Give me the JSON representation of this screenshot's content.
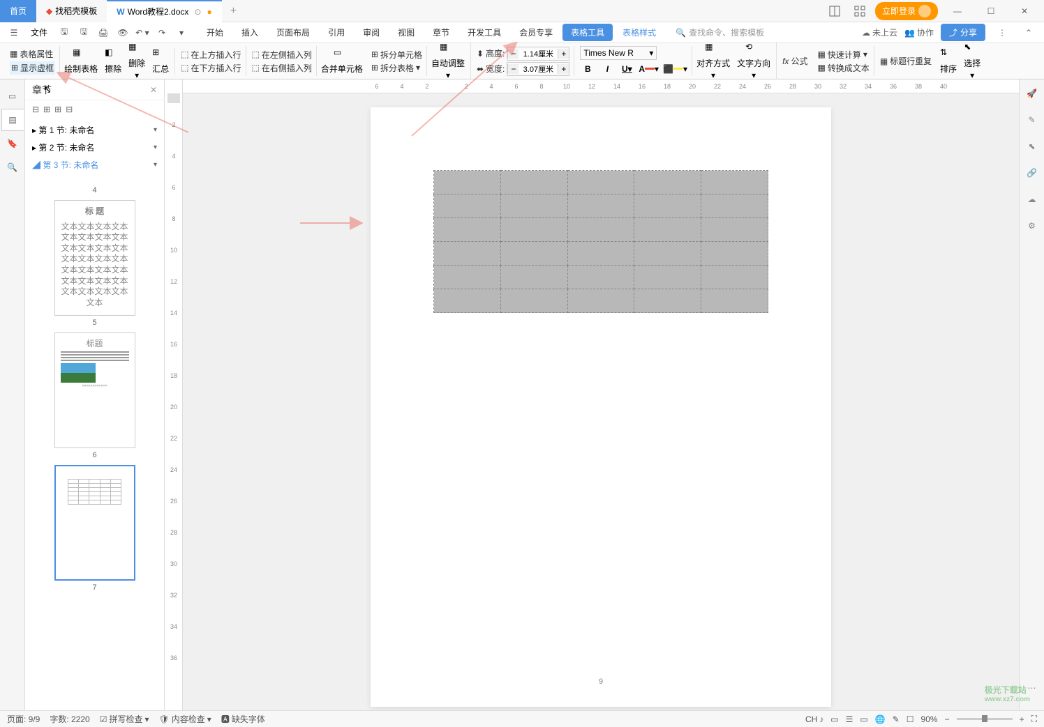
{
  "titlebar": {
    "home": "首页",
    "template": "找稻壳模板",
    "doc": "Word教程2.docx",
    "login": "立即登录"
  },
  "menubar": {
    "file": "文件",
    "tabs": [
      "开始",
      "插入",
      "页面布局",
      "引用",
      "审阅",
      "视图",
      "章节",
      "开发工具",
      "会员专享"
    ],
    "active_tab": "表格工具",
    "style_tab": "表格样式",
    "search_placeholder": "查找命令、搜索模板",
    "cloud": "未上云",
    "collab": "协作",
    "share": "分享"
  },
  "toolbar": {
    "table_props": "表格属性",
    "show_frame": "显示虚框",
    "draw_table": "绘制表格",
    "eraser": "擦除",
    "delete": "删除",
    "summary": "汇总",
    "insert_above": "在上方插入行",
    "insert_below": "在下方插入行",
    "insert_left": "在左侧插入列",
    "insert_right": "在右侧插入列",
    "merge_cells": "合并单元格",
    "split_cells": "拆分单元格",
    "split_table": "拆分表格",
    "auto_adjust": "自动调整",
    "height_label": "高度:",
    "height_value": "1.14厘米",
    "width_label": "宽度:",
    "width_value": "3.07厘米",
    "font": "Times New R",
    "align": "对齐方式",
    "text_dir": "文字方向",
    "formula": "公式",
    "quick_calc": "快速计算",
    "repeat_header": "标题行重复",
    "to_text": "转换成文本",
    "sort": "排序",
    "select": "选择"
  },
  "sidebar": {
    "title": "章节",
    "sections": [
      {
        "label": "第 1 节: 未命名",
        "active": false
      },
      {
        "label": "第 2 节: 未命名",
        "active": false
      },
      {
        "label": "第 3 节: 未命名",
        "active": true
      }
    ],
    "thumbs": [
      {
        "num": "4"
      },
      {
        "num": "5"
      },
      {
        "num": "6"
      },
      {
        "num": "7"
      }
    ]
  },
  "ruler_h": [
    "6",
    "4",
    "2",
    "",
    "2",
    "4",
    "6",
    "8",
    "10",
    "12",
    "14",
    "16",
    "18",
    "20",
    "22",
    "24",
    "26",
    "28",
    "30",
    "32",
    "34",
    "36",
    "38",
    "40"
  ],
  "ruler_v": [
    "2",
    "4",
    "6",
    "8",
    "10",
    "12",
    "14",
    "16",
    "18",
    "20",
    "22",
    "24",
    "26",
    "28",
    "30",
    "32",
    "34",
    "36"
  ],
  "page": {
    "current_num": "9"
  },
  "statusbar": {
    "page": "页面: 9/9",
    "words": "字数: 2220",
    "spell": "拼写检查",
    "content": "内容检查",
    "missing_font": "缺失字体",
    "ime": "CH",
    "zoom": "90%"
  },
  "watermark": {
    "line1": "极光下载站",
    "line2": "www.xz7.com"
  }
}
